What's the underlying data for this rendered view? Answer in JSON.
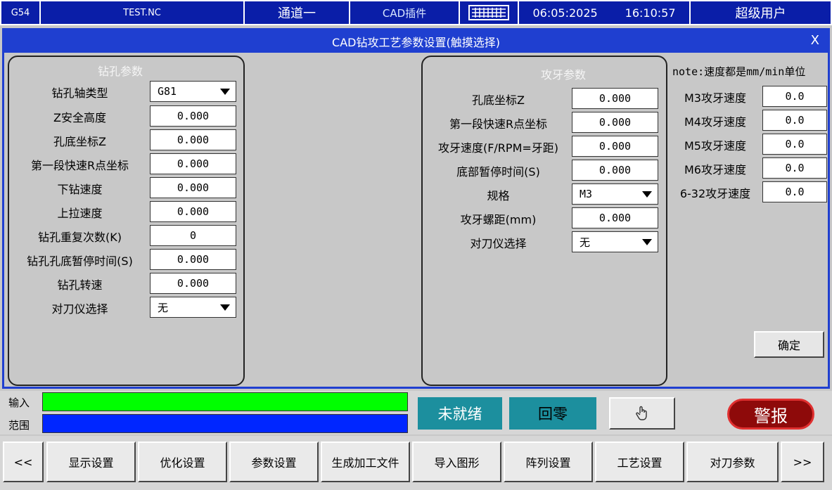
{
  "status_bar": {
    "coord_system": "G54",
    "program": "TEST.NC",
    "channel": "通道一",
    "plugin": "CAD插件",
    "date": "06:05:2025",
    "time": "16:10:57",
    "user": "超级用户"
  },
  "dialog": {
    "title": "CAD钻攻工艺参数设置(触摸选择)",
    "close": "X",
    "drill": {
      "title": "钻孔参数",
      "fields": [
        {
          "label": "钻孔轴类型",
          "value": "G81",
          "type": "select"
        },
        {
          "label": "Z安全高度",
          "value": "0.000",
          "type": "input"
        },
        {
          "label": "孔底坐标Z",
          "value": "0.000",
          "type": "input"
        },
        {
          "label": "第一段快速R点坐标",
          "value": "0.000",
          "type": "input"
        },
        {
          "label": "下钻速度",
          "value": "0.000",
          "type": "input"
        },
        {
          "label": "上拉速度",
          "value": "0.000",
          "type": "input"
        },
        {
          "label": "钻孔重复次数(K)",
          "value": "0",
          "type": "input"
        },
        {
          "label": "钻孔孔底暂停时间(S)",
          "value": "0.000",
          "type": "input"
        },
        {
          "label": "钻孔转速",
          "value": "0.000",
          "type": "input"
        },
        {
          "label": "对刀仪选择",
          "value": "无",
          "type": "select"
        }
      ]
    },
    "tap": {
      "title": "攻牙参数",
      "fields": [
        {
          "label": "孔底坐标Z",
          "value": "0.000",
          "type": "input"
        },
        {
          "label": "第一段快速R点坐标",
          "value": "0.000",
          "type": "input"
        },
        {
          "label": "攻牙速度(F/RPM=牙距)",
          "value": "0.000",
          "type": "input"
        },
        {
          "label": "底部暂停时间(S)",
          "value": "0.000",
          "type": "input"
        },
        {
          "label": "规格",
          "value": "M3",
          "type": "select"
        },
        {
          "label": "攻牙螺距(mm)",
          "value": "0.000",
          "type": "input"
        },
        {
          "label": "对刀仪选择",
          "value": "无",
          "type": "select"
        }
      ]
    },
    "speeds": {
      "note": "note:速度都是mm/min单位",
      "fields": [
        {
          "label": "M3攻牙速度",
          "value": "0.0"
        },
        {
          "label": "M4攻牙速度",
          "value": "0.0"
        },
        {
          "label": "M5攻牙速度",
          "value": "0.0"
        },
        {
          "label": "M6攻牙速度",
          "value": "0.0"
        },
        {
          "label": "6-32攻牙速度",
          "value": "0.0"
        }
      ]
    },
    "ok": "确定"
  },
  "input_area": {
    "input_label": "输入",
    "range_label": "范围",
    "input_color": "#00ff00",
    "range_color": "#0026ff",
    "not_ready": "未就绪",
    "home": "回零",
    "alarm": "警报"
  },
  "function_keys": [
    "<<",
    "显示设置",
    "优化设置",
    "参数设置",
    "生成加工文件",
    "导入图形",
    "阵列设置",
    "工艺设置",
    "对刀参数",
    ">>"
  ]
}
